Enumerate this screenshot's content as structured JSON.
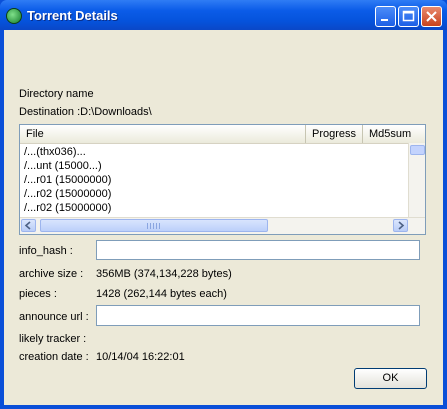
{
  "window": {
    "title": "Torrent Details"
  },
  "labels": {
    "directory_name": "Directory name",
    "destination": "Destination :D:\\Downloads\\",
    "info_hash": "info_hash :",
    "archive_size": "archive size :",
    "pieces": "pieces :",
    "announce_url": "announce url :",
    "likely_tracker": "likely tracker :",
    "creation_date": "creation date :"
  },
  "values": {
    "info_hash": "",
    "archive_size": "356MB (374,134,228 bytes)",
    "pieces": "1428 (262,144 bytes each)",
    "announce_url": "",
    "likely_tracker": "",
    "creation_date": "10/14/04 16:22:01"
  },
  "file_list": {
    "columns": [
      "File",
      "Progress",
      "Md5sum"
    ],
    "rows": [
      "/...(thx036)...",
      "/...unt (15000...)",
      "/...r01 (15000000)",
      "/...r02 (15000000)",
      "/...r02 (15000000)"
    ]
  },
  "buttons": {
    "ok": "OK"
  }
}
